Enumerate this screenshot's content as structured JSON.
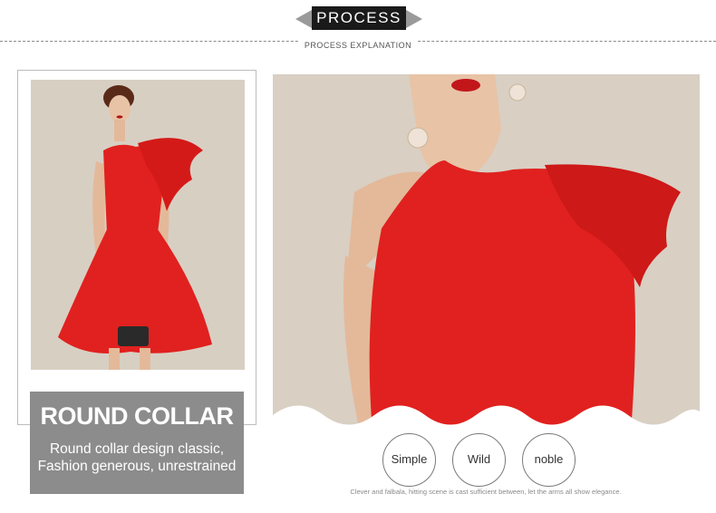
{
  "header": {
    "title": "PROCESS",
    "subtitle": "PROCESS EXPLANATION"
  },
  "feature": {
    "title": "ROUND COLLAR",
    "description_line1": "Round collar design classic,",
    "description_line2": "Fashion generous, unrestrained"
  },
  "badges": [
    "Simple",
    "Wild",
    "noble"
  ],
  "caption": "Clever and falbala, hitting scene is cast sufficient between, let the arms all show elegance.",
  "colors": {
    "dress_red": "#e0211f",
    "background_beige": "#d8cfc3",
    "label_gray": "#8c8c8c",
    "ribbon_black": "#1a1a1a"
  }
}
